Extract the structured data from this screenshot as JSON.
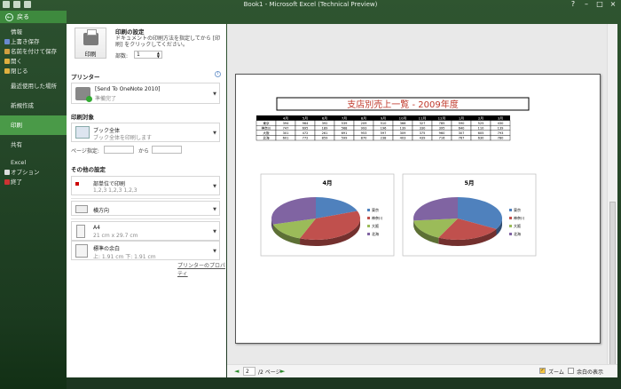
{
  "window": {
    "title": "Book1 - Microsoft Excel (Technical Preview)"
  },
  "backstage": {
    "back_label": "戻る"
  },
  "nav": {
    "items": [
      "情報",
      "上書き保存",
      "名前を付けて保存",
      "開く",
      "閉じる",
      "最近使用した場所",
      "新規作成",
      "印刷",
      "共有",
      "Excel",
      "オプション",
      "終了"
    ]
  },
  "print": {
    "heading": "印刷の設定",
    "print_button": "印刷",
    "description": "ドキュメントの印刷方法を指定してから [印刷] をクリックしてください。",
    "copies_label": "部数:",
    "copies_value": "1"
  },
  "printer": {
    "heading": "プリンター",
    "name": "[Send To OneNote 2010]",
    "status": "準備完了",
    "properties_link": "プリンターのプロパティ"
  },
  "target": {
    "heading": "印刷対象",
    "option": "ブック全体",
    "option_desc": "ブック全体を印刷します",
    "pages_label": "ページ指定:",
    "pages_to": "から"
  },
  "settings": {
    "heading": "その他の設定",
    "collate": "部単位で印刷",
    "collate_desc": "1,2,3    1,2,3    1,2,3",
    "orientation": "横方向",
    "paper": "A4",
    "paper_size": "21 cm x 29.7 cm",
    "margins": "標準の余白",
    "margins_desc": "上: 1.91 cm    下: 1.91 cm"
  },
  "status": {
    "page_value": "2",
    "page_of": "/2 ページ",
    "zoom_label": "ズーム",
    "margins_label": "余白の表示"
  },
  "chart_data": [
    {
      "type": "table",
      "title": "支店別売上一覧 - 2009年度",
      "columns": [
        "",
        "4月",
        "5月",
        "6月",
        "7月",
        "8月",
        "9月",
        "10月",
        "11月",
        "12月",
        "1月",
        "2月",
        "3月"
      ],
      "rows": [
        [
          "東京",
          "394",
          "964",
          "392",
          "539",
          "209",
          "510",
          "366",
          "327",
          "785",
          "590",
          "525",
          "430"
        ],
        [
          "神奈川",
          "747",
          "695",
          "189",
          "568",
          "993",
          "196",
          "139",
          "330",
          "395",
          "640",
          "110",
          "139"
        ],
        [
          "大阪",
          "301",
          "472",
          "261",
          "691",
          "953",
          "597",
          "309",
          "375",
          "960",
          "307",
          "605",
          "793"
        ],
        [
          "北海",
          "601",
          "772",
          "859",
          "599",
          "870",
          "238",
          "403",
          "439",
          "716",
          "767",
          "630",
          "780"
        ]
      ]
    },
    {
      "type": "pie",
      "title": "4月",
      "categories": [
        "東京",
        "神奈川",
        "大阪",
        "北海"
      ],
      "values": [
        394,
        747,
        301,
        601
      ],
      "colors": [
        "#4f81bd",
        "#c0504d",
        "#9bbb59",
        "#8064a2"
      ]
    },
    {
      "type": "pie",
      "title": "5月",
      "categories": [
        "東京",
        "神奈川",
        "大阪",
        "北海"
      ],
      "values": [
        964,
        695,
        472,
        772
      ],
      "colors": [
        "#4f81bd",
        "#c0504d",
        "#9bbb59",
        "#8064a2"
      ]
    }
  ]
}
